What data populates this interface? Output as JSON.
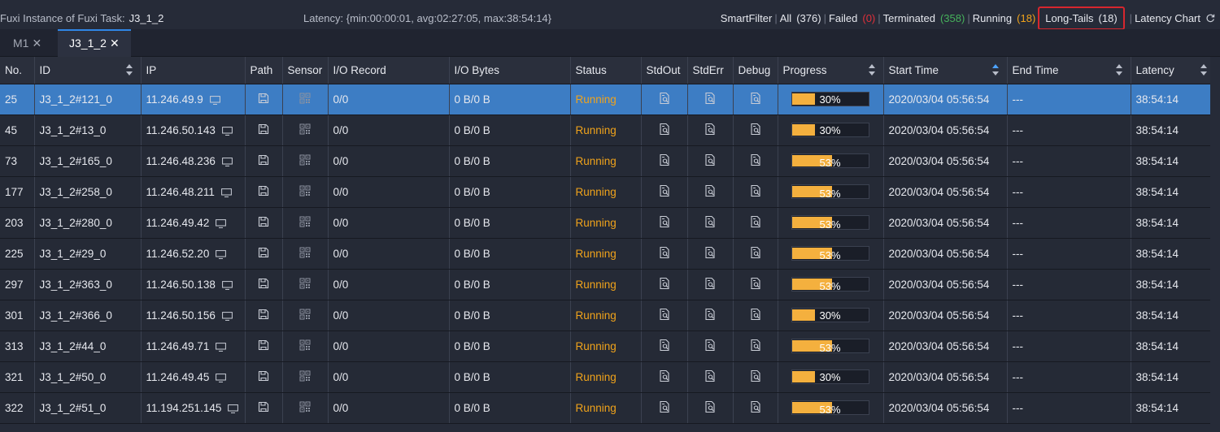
{
  "header": {
    "title_prefix": "Fuxi Instance of Fuxi Task:",
    "task_name": "J3_1_2",
    "latency": "Latency: {min:00:00:01, avg:02:27:05, max:38:54:14}",
    "smart_filter_label": "SmartFilter",
    "filters": [
      {
        "label": "All",
        "count": "(376)",
        "color": "default"
      },
      {
        "label": "Failed",
        "count": "(0)",
        "color": "red"
      },
      {
        "label": "Terminated",
        "count": "(358)",
        "color": "green"
      },
      {
        "label": "Running",
        "count": "(18)",
        "color": "orange"
      },
      {
        "label": "Long-Tails",
        "count": "(18)",
        "color": "default"
      }
    ],
    "latency_chart_label": "Latency Chart"
  },
  "tabs": [
    {
      "label": "M1",
      "active": false
    },
    {
      "label": "J3_1_2",
      "active": true
    }
  ],
  "table": {
    "columns": [
      "No.",
      "ID",
      "IP",
      "Path",
      "Sensor",
      "I/O Record",
      "I/O Bytes",
      "Status",
      "StdOut",
      "StdErr",
      "Debug",
      "Progress",
      "Start Time",
      "End Time",
      "Latency"
    ],
    "rows": [
      {
        "no": "25",
        "id": "J3_1_2#121_0",
        "ip": "11.246.49.9",
        "io_record": "0/0",
        "io_bytes": "0 B/0 B",
        "status": "Running",
        "progress": 30,
        "progress_label": "30%",
        "start": "2020/03/04 05:56:54",
        "end": "---",
        "latency": "38:54:14",
        "selected": true
      },
      {
        "no": "45",
        "id": "J3_1_2#13_0",
        "ip": "11.246.50.143",
        "io_record": "0/0",
        "io_bytes": "0 B/0 B",
        "status": "Running",
        "progress": 30,
        "progress_label": "30%",
        "start": "2020/03/04 05:56:54",
        "end": "---",
        "latency": "38:54:14",
        "selected": false
      },
      {
        "no": "73",
        "id": "J3_1_2#165_0",
        "ip": "11.246.48.236",
        "io_record": "0/0",
        "io_bytes": "0 B/0 B",
        "status": "Running",
        "progress": 53,
        "progress_label": "53%",
        "start": "2020/03/04 05:56:54",
        "end": "---",
        "latency": "38:54:14",
        "selected": false
      },
      {
        "no": "177",
        "id": "J3_1_2#258_0",
        "ip": "11.246.48.211",
        "io_record": "0/0",
        "io_bytes": "0 B/0 B",
        "status": "Running",
        "progress": 53,
        "progress_label": "53%",
        "start": "2020/03/04 05:56:54",
        "end": "---",
        "latency": "38:54:14",
        "selected": false
      },
      {
        "no": "203",
        "id": "J3_1_2#280_0",
        "ip": "11.246.49.42",
        "io_record": "0/0",
        "io_bytes": "0 B/0 B",
        "status": "Running",
        "progress": 53,
        "progress_label": "53%",
        "start": "2020/03/04 05:56:54",
        "end": "---",
        "latency": "38:54:14",
        "selected": false
      },
      {
        "no": "225",
        "id": "J3_1_2#29_0",
        "ip": "11.246.52.20",
        "io_record": "0/0",
        "io_bytes": "0 B/0 B",
        "status": "Running",
        "progress": 53,
        "progress_label": "53%",
        "start": "2020/03/04 05:56:54",
        "end": "---",
        "latency": "38:54:14",
        "selected": false
      },
      {
        "no": "297",
        "id": "J3_1_2#363_0",
        "ip": "11.246.50.138",
        "io_record": "0/0",
        "io_bytes": "0 B/0 B",
        "status": "Running",
        "progress": 53,
        "progress_label": "53%",
        "start": "2020/03/04 05:56:54",
        "end": "---",
        "latency": "38:54:14",
        "selected": false
      },
      {
        "no": "301",
        "id": "J3_1_2#366_0",
        "ip": "11.246.50.156",
        "io_record": "0/0",
        "io_bytes": "0 B/0 B",
        "status": "Running",
        "progress": 30,
        "progress_label": "30%",
        "start": "2020/03/04 05:56:54",
        "end": "---",
        "latency": "38:54:14",
        "selected": false
      },
      {
        "no": "313",
        "id": "J3_1_2#44_0",
        "ip": "11.246.49.71",
        "io_record": "0/0",
        "io_bytes": "0 B/0 B",
        "status": "Running",
        "progress": 53,
        "progress_label": "53%",
        "start": "2020/03/04 05:56:54",
        "end": "---",
        "latency": "38:54:14",
        "selected": false
      },
      {
        "no": "321",
        "id": "J3_1_2#50_0",
        "ip": "11.246.49.45",
        "io_record": "0/0",
        "io_bytes": "0 B/0 B",
        "status": "Running",
        "progress": 30,
        "progress_label": "30%",
        "start": "2020/03/04 05:56:54",
        "end": "---",
        "latency": "38:54:14",
        "selected": false
      },
      {
        "no": "322",
        "id": "J3_1_2#51_0",
        "ip": "11.194.251.145",
        "io_record": "0/0",
        "io_bytes": "0 B/0 B",
        "status": "Running",
        "progress": 53,
        "progress_label": "53%",
        "start": "2020/03/04 05:56:54",
        "end": "---",
        "latency": "38:54:14",
        "selected": false
      }
    ]
  },
  "colors": {
    "accent": "#2f86e6",
    "selected_row": "#3d7dc4",
    "running": "#f0a31b",
    "failed": "#e0303a",
    "terminated": "#46b15b",
    "progress_fill": "#f4b03e",
    "highlight_border": "#d6262e"
  },
  "icons": {
    "tab_close": "close-icon",
    "ip_monitor": "monitor-icon",
    "path": "save-icon",
    "sensor": "qr-code-icon",
    "log": "file-search-icon",
    "refresh": "refresh-icon"
  }
}
